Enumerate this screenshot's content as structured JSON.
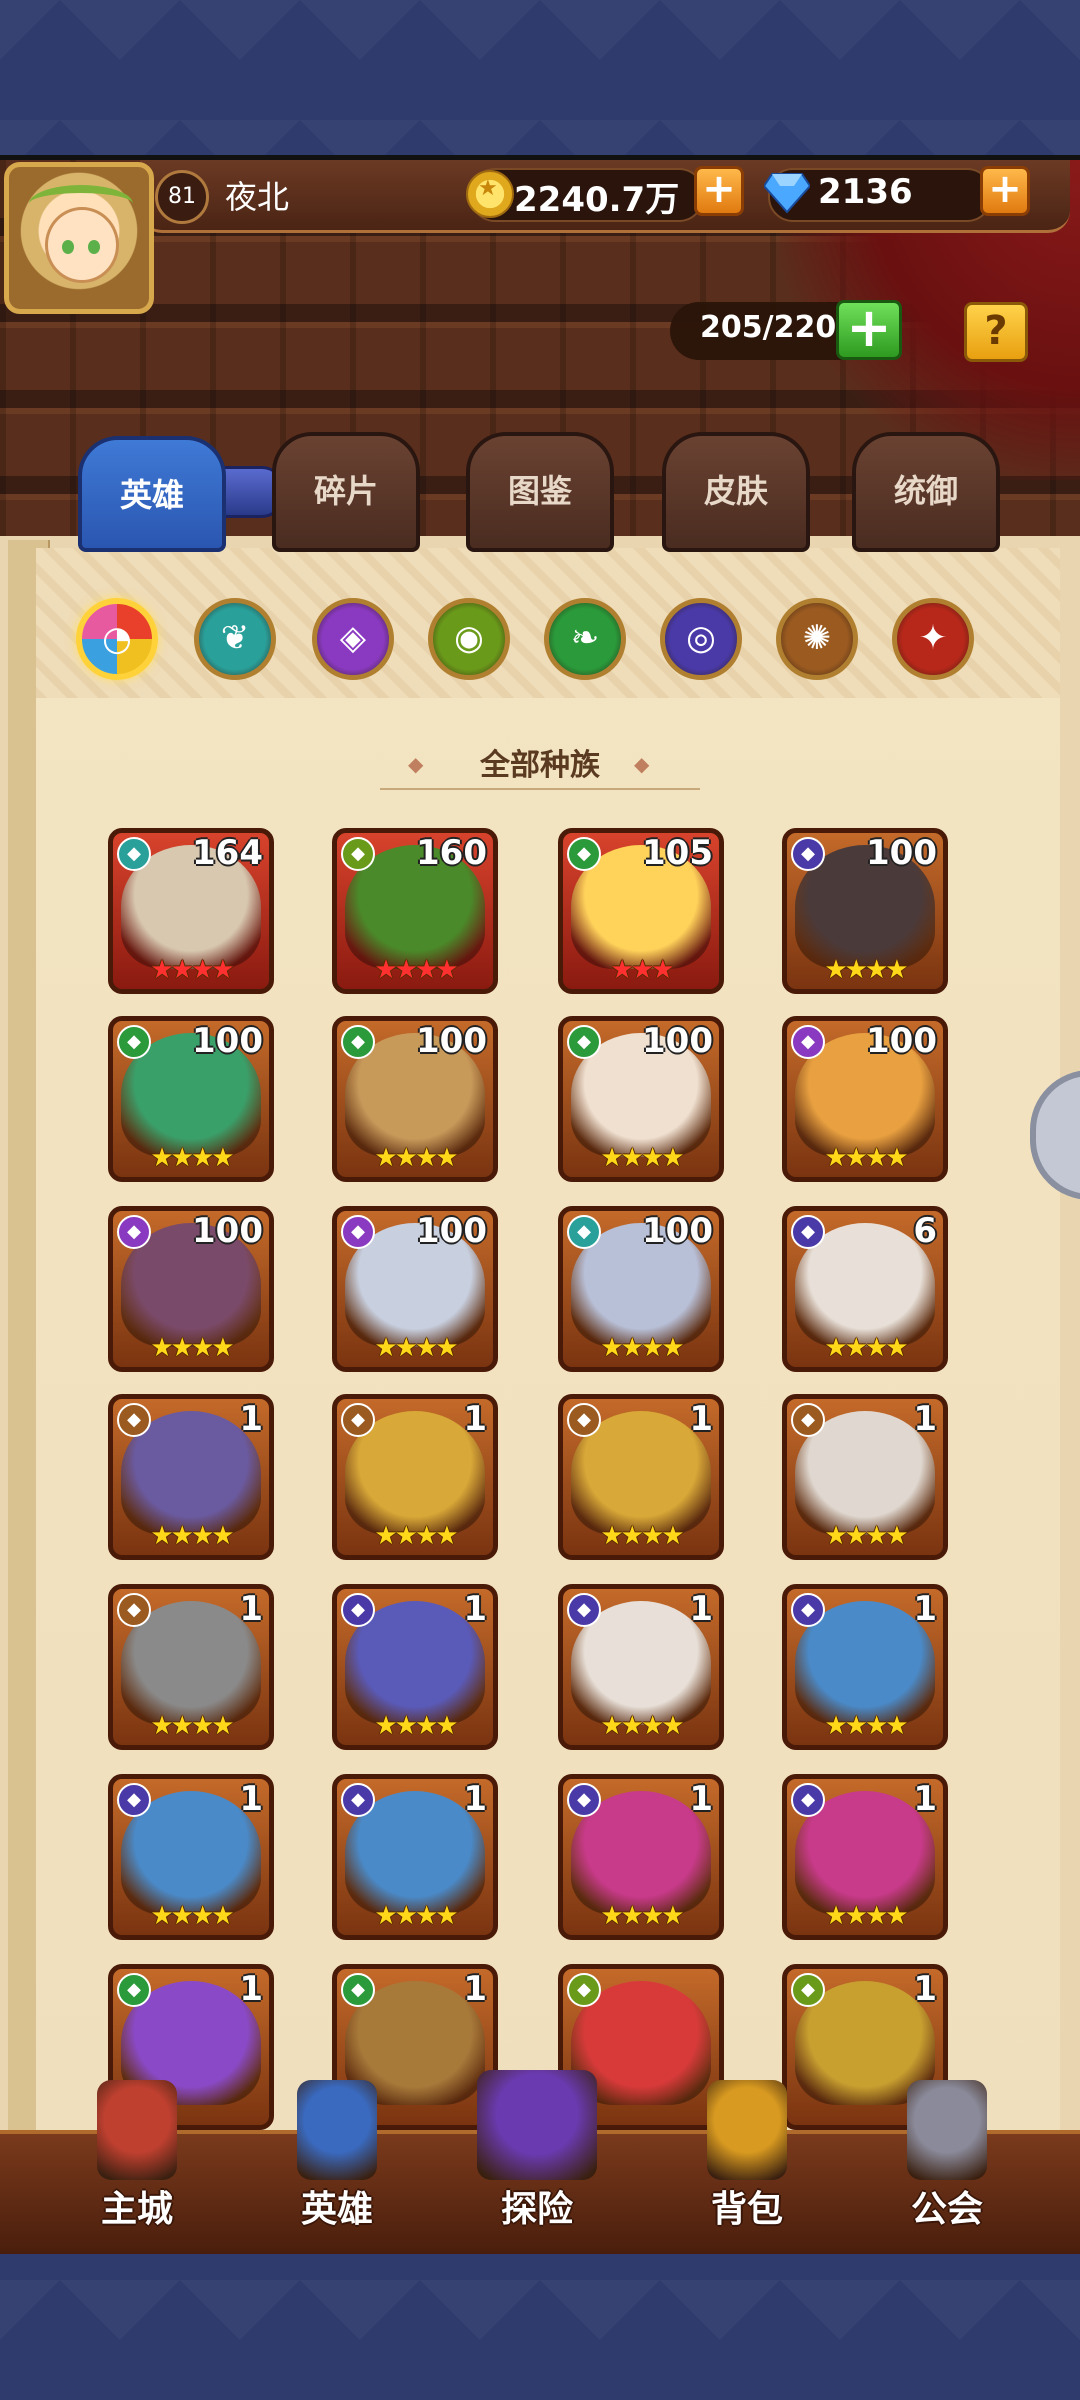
{
  "player": {
    "level": "81",
    "name": "夜北"
  },
  "resources": {
    "gold": "2240.7万",
    "gems": "2136"
  },
  "capacity": {
    "value": "205/220"
  },
  "tabs": [
    {
      "label": "英雄",
      "active": true
    },
    {
      "label": "碎片",
      "active": false
    },
    {
      "label": "图鉴",
      "active": false
    },
    {
      "label": "皮肤",
      "active": false
    },
    {
      "label": "统御",
      "active": false
    }
  ],
  "filters": [
    {
      "name": "all-races-icon",
      "color": "#e84a2a",
      "glyph": "◔"
    },
    {
      "name": "race-teal-icon",
      "color": "#2aa09a",
      "glyph": "❦"
    },
    {
      "name": "race-purple-icon",
      "color": "#8a3ac0",
      "glyph": "◈"
    },
    {
      "name": "race-olive-icon",
      "color": "#6a9a1a",
      "glyph": "◉"
    },
    {
      "name": "race-green-icon",
      "color": "#2a9a3a",
      "glyph": "❧"
    },
    {
      "name": "race-indigo-icon",
      "color": "#4a3aa8",
      "glyph": "◎"
    },
    {
      "name": "race-brown-icon",
      "color": "#9a5a20",
      "glyph": "✺"
    },
    {
      "name": "race-red-icon",
      "color": "#b8281a",
      "glyph": "✦"
    }
  ],
  "section_title": "全部种族",
  "heroes": [
    {
      "level": "164",
      "stars": "★★★★",
      "star_color": "red",
      "race_color": "#2aa09a",
      "portrait": "#d8c8b0"
    },
    {
      "level": "160",
      "stars": "★★★★",
      "star_color": "red",
      "race_color": "#6a9a1a",
      "portrait": "#4a8a2a"
    },
    {
      "level": "105",
      "stars": "★★★",
      "star_color": "red",
      "race_color": "#2a9a3a",
      "portrait": "#ffd25a"
    },
    {
      "level": "100",
      "stars": "★★★★",
      "star_color": "gold",
      "race_color": "#4a3aa8",
      "portrait": "#4a3a3a"
    },
    {
      "level": "100",
      "stars": "★★★★",
      "star_color": "gold",
      "race_color": "#2a9a3a",
      "portrait": "#3aa06a"
    },
    {
      "level": "100",
      "stars": "★★★★",
      "star_color": "gold",
      "race_color": "#2a9a3a",
      "portrait": "#c89a5a"
    },
    {
      "level": "100",
      "stars": "★★★★",
      "star_color": "gold",
      "race_color": "#2a9a3a",
      "portrait": "#f0e0d0"
    },
    {
      "level": "100",
      "stars": "★★★★",
      "star_color": "gold",
      "race_color": "#8a3ac0",
      "portrait": "#e8a040"
    },
    {
      "level": "100",
      "stars": "★★★★",
      "star_color": "gold",
      "race_color": "#8a3ac0",
      "portrait": "#7a4a6a"
    },
    {
      "level": "100",
      "stars": "★★★★",
      "star_color": "gold",
      "race_color": "#8a3ac0",
      "portrait": "#c8d0e0"
    },
    {
      "level": "100",
      "stars": "★★★★",
      "star_color": "gold",
      "race_color": "#2aa09a",
      "portrait": "#b8c0d8"
    },
    {
      "level": "6",
      "stars": "★★★★",
      "star_color": "gold",
      "race_color": "#4a3aa8",
      "portrait": "#e8e0d8"
    },
    {
      "level": "1",
      "stars": "★★★★",
      "star_color": "gold",
      "race_color": "#9a5a20",
      "portrait": "#6a5aa0"
    },
    {
      "level": "1",
      "stars": "★★★★",
      "star_color": "gold",
      "race_color": "#9a5a20",
      "portrait": "#d8a838"
    },
    {
      "level": "1",
      "stars": "★★★★",
      "star_color": "gold",
      "race_color": "#9a5a20",
      "portrait": "#d8a838"
    },
    {
      "level": "1",
      "stars": "★★★★",
      "star_color": "gold",
      "race_color": "#9a5a20",
      "portrait": "#e0d8d0"
    },
    {
      "level": "1",
      "stars": "★★★★",
      "star_color": "gold",
      "race_color": "#9a5a20",
      "portrait": "#8a8a8a"
    },
    {
      "level": "1",
      "stars": "★★★★",
      "star_color": "gold",
      "race_color": "#4a3aa8",
      "portrait": "#5a5ab8"
    },
    {
      "level": "1",
      "stars": "★★★★",
      "star_color": "gold",
      "race_color": "#4a3aa8",
      "portrait": "#e8e0d8"
    },
    {
      "level": "1",
      "stars": "★★★★",
      "star_color": "gold",
      "race_color": "#4a3aa8",
      "portrait": "#4a8ac8"
    },
    {
      "level": "1",
      "stars": "★★★★",
      "star_color": "gold",
      "race_color": "#4a3aa8",
      "portrait": "#4a8ac8"
    },
    {
      "level": "1",
      "stars": "★★★★",
      "star_color": "gold",
      "race_color": "#4a3aa8",
      "portrait": "#4a8ac8"
    },
    {
      "level": "1",
      "stars": "★★★★",
      "star_color": "gold",
      "race_color": "#4a3aa8",
      "portrait": "#c83a8a"
    },
    {
      "level": "1",
      "stars": "★★★★",
      "star_color": "gold",
      "race_color": "#4a3aa8",
      "portrait": "#c83a8a"
    },
    {
      "level": "1",
      "stars": "",
      "star_color": "gold",
      "race_color": "#2a9a3a",
      "portrait": "#8a4ac8"
    },
    {
      "level": "1",
      "stars": "",
      "star_color": "gold",
      "race_color": "#2a9a3a",
      "portrait": "#a87a3a"
    },
    {
      "level": "",
      "stars": "",
      "star_color": "gold",
      "race_color": "#6a9a1a",
      "portrait": "#d83a3a"
    },
    {
      "level": "1",
      "stars": "",
      "star_color": "gold",
      "race_color": "#6a9a1a",
      "portrait": "#c8a030"
    }
  ],
  "nav": [
    {
      "label": "主城",
      "icon": "castle-icon",
      "color": "#c04030"
    },
    {
      "label": "英雄",
      "icon": "hero-icon",
      "color": "#3a6ac0"
    },
    {
      "label": "探险",
      "icon": "portal-icon",
      "color": "#6a3ab0"
    },
    {
      "label": "背包",
      "icon": "backpack-icon",
      "color": "#d89a20"
    },
    {
      "label": "公会",
      "icon": "guild-tower-icon",
      "color": "#8a8a9a"
    }
  ]
}
